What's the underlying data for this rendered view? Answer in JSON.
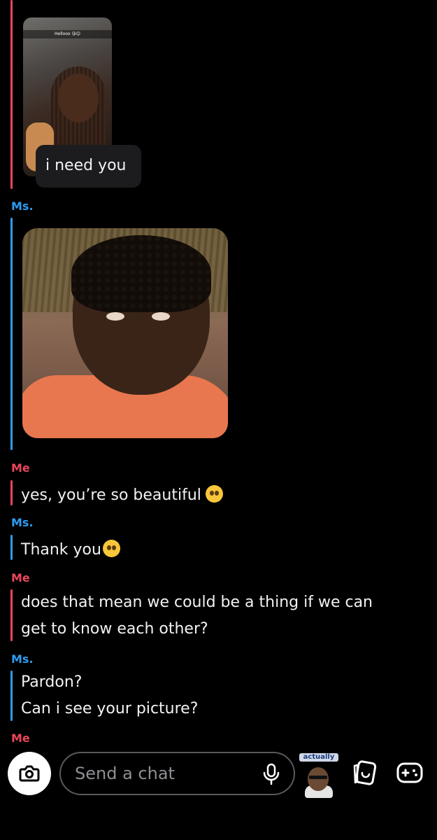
{
  "thread": {
    "snap_caption": "Hellooo 😘😊",
    "reply_text": "i need you",
    "messages": [
      {
        "sender": "Ms.",
        "type": "photo"
      },
      {
        "sender": "Me",
        "text": "yes, you’re so beautiful",
        "emoji": "pleading-face"
      },
      {
        "sender": "Ms.",
        "text": "Thank you",
        "emoji": "smiling-face"
      },
      {
        "sender": "Me",
        "lines": [
          "does that mean we could be a thing if we can",
          "get to know each other?"
        ]
      },
      {
        "sender": "Ms.",
        "lines": [
          "Pardon?",
          "Can i see your picture?"
        ]
      },
      {
        "sender": "Me"
      }
    ]
  },
  "chat_bar": {
    "placeholder": "Send a chat",
    "bitmoji_label": "actually"
  },
  "colors": {
    "me": "#e8475b",
    "ms": "#2d9cf0",
    "background": "#000000"
  },
  "icons": [
    "camera-icon",
    "microphone-icon",
    "sticker-icon",
    "game-controller-icon"
  ]
}
